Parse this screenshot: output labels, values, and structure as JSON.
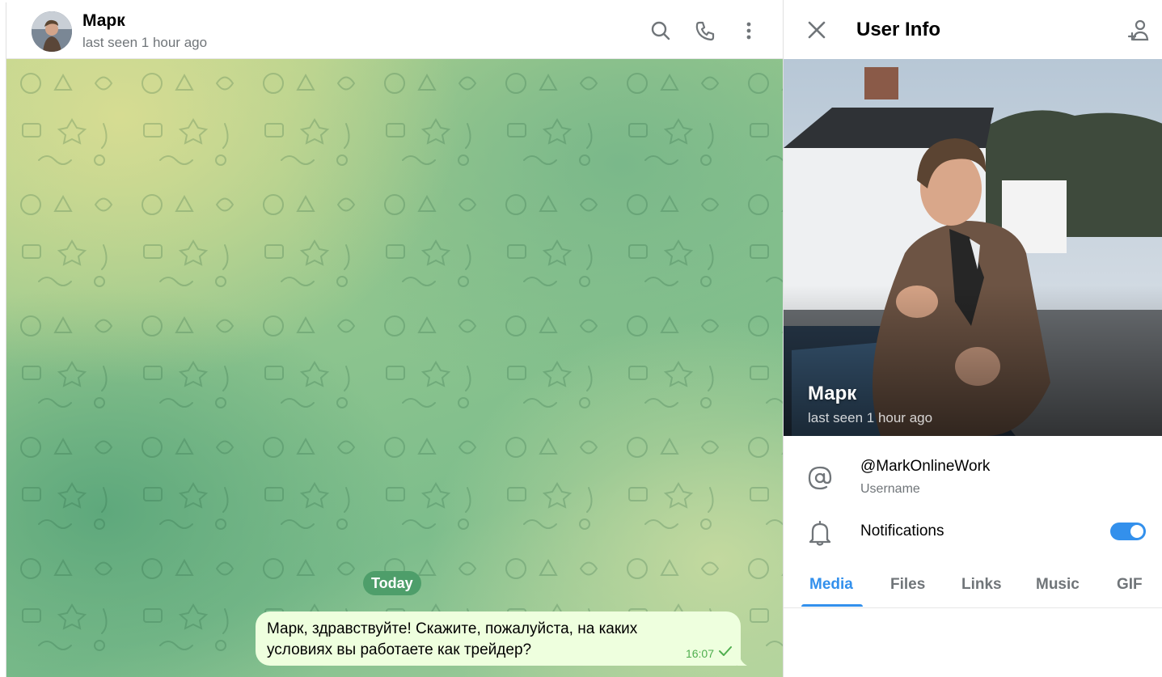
{
  "chat": {
    "peer_name": "Марк",
    "peer_status": "last seen 1 hour ago",
    "date_separator": "Today",
    "message": {
      "text": "Марк, здравствуйте! Скажите, пожалуйста, на каких условиях вы работаете как трейдер?",
      "time": "16:07",
      "status_icon": "check-icon"
    },
    "header_icons": [
      "search-icon",
      "phone-icon",
      "more-vertical-icon"
    ]
  },
  "info": {
    "title": "User Info",
    "close_icon": "close-icon",
    "add_contact_icon": "add-contact-icon",
    "photo_name": "Марк",
    "photo_status": "last seen 1 hour ago",
    "username": "@MarkOnlineWork",
    "username_label": "Username",
    "notifications_label": "Notifications",
    "notifications_enabled": true,
    "tabs": [
      {
        "label": "Media",
        "active": true
      },
      {
        "label": "Files",
        "active": false
      },
      {
        "label": "Links",
        "active": false
      },
      {
        "label": "Music",
        "active": false
      },
      {
        "label": "GIF",
        "active": false
      }
    ]
  },
  "colors": {
    "accent": "#3390ec",
    "bubble_out": "#eeffde",
    "time_out": "#4fae4e",
    "date_pill": "#4e9e6a",
    "secondary_text": "#707579"
  }
}
